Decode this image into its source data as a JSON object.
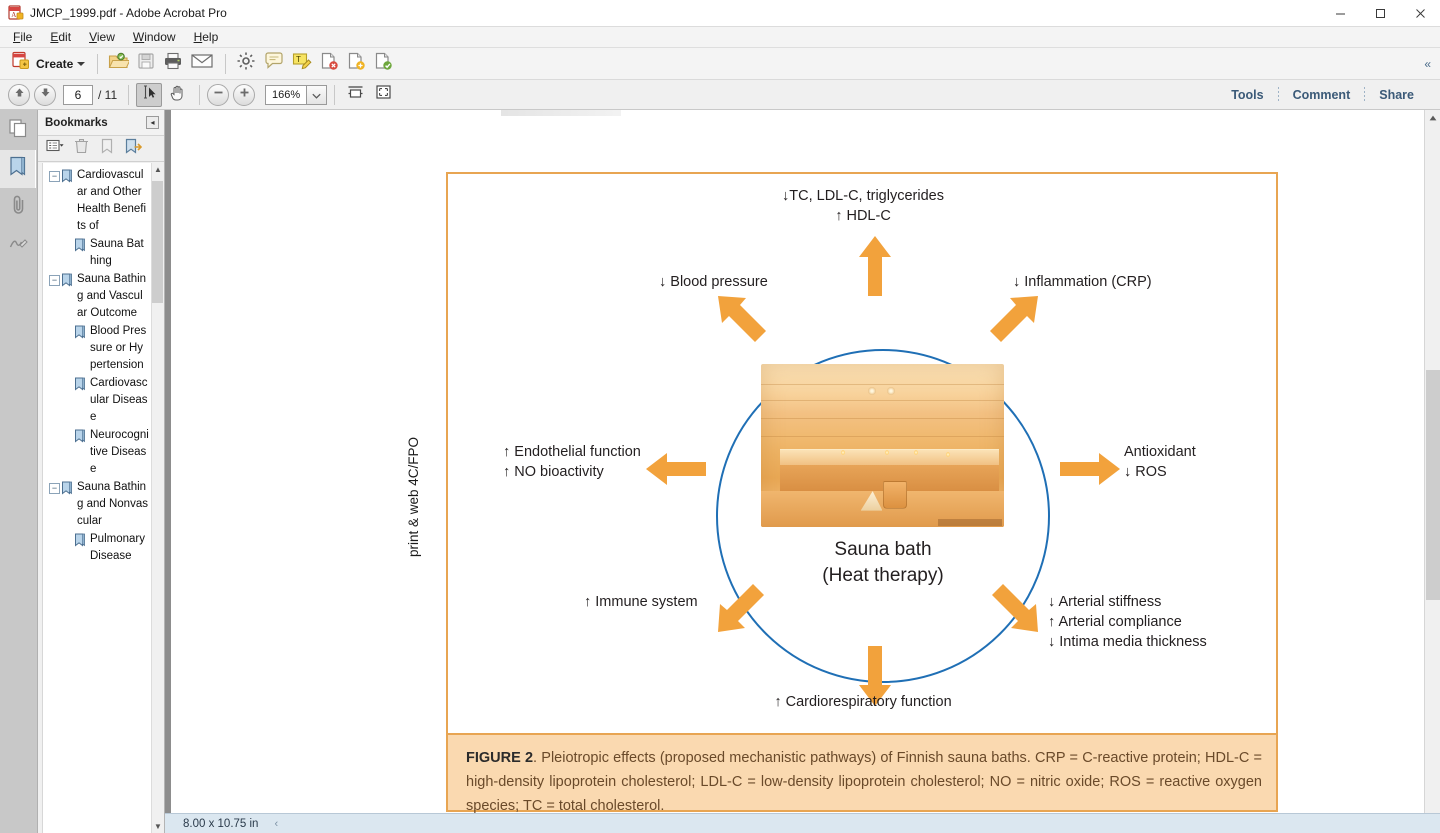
{
  "window": {
    "title": "JMCP_1999.pdf - Adobe Acrobat Pro",
    "app_icon": "acrobat-icon",
    "minimize_label": "─",
    "maximize_label": "☐",
    "close_label": "✕"
  },
  "menubar": {
    "items": [
      {
        "label": "File",
        "mnemonic": "F"
      },
      {
        "label": "Edit",
        "mnemonic": "E"
      },
      {
        "label": "View",
        "mnemonic": "V"
      },
      {
        "label": "Window",
        "mnemonic": "W"
      },
      {
        "label": "Help",
        "mnemonic": "H"
      }
    ]
  },
  "toolbar": {
    "create_label": "Create",
    "icons": [
      "create-pdf-icon",
      "open-file-icon",
      "save-icon",
      "print-icon",
      "email-icon",
      "settings-icon",
      "sticky-note-icon",
      "highlight-text-icon",
      "export-pdf-icon",
      "create-pdf-tool-icon",
      "send-for-review-icon"
    ],
    "collapse_label": "«"
  },
  "navbar": {
    "previous_page_icon": "arrow-up-icon",
    "next_page_icon": "arrow-down-icon",
    "page_number": "6",
    "page_total": "/ 11",
    "select_tool_icon": "select-text-icon",
    "hand_tool_icon": "hand-icon",
    "zoom_out_icon": "zoom-out-icon",
    "zoom_in_icon": "zoom-in-icon",
    "zoom_level": "166%",
    "zoom_dropdown_icon": "chevron-down-icon",
    "fit_width_icon": "fit-width-icon",
    "fit_page_icon": "fit-page-icon",
    "right_buttons": [
      "Tools",
      "Comment",
      "Share"
    ]
  },
  "rail": {
    "items": [
      {
        "name": "page-thumbnails",
        "icon": "pages-icon",
        "active": false
      },
      {
        "name": "bookmarks",
        "icon": "bookmark-icon",
        "active": true
      },
      {
        "name": "attachments",
        "icon": "paperclip-icon",
        "active": false
      },
      {
        "name": "signatures",
        "icon": "signature-icon",
        "active": false
      }
    ]
  },
  "bookmarks_panel": {
    "title": "Bookmarks",
    "collapse_label": "◂",
    "toolbar_icons": [
      "options-menu-icon",
      "delete-bookmark-icon",
      "new-bookmark-icon",
      "expand-bookmark-icon"
    ],
    "scroll_up_label": "▲",
    "scroll_down_label": "▼",
    "tree": [
      {
        "label": "Cardiovascular and Other Health Benefits of",
        "level": 0,
        "expander": "−"
      },
      {
        "label": "Sauna Bathing",
        "level": 1,
        "expander": ""
      },
      {
        "label": "Sauna Bathing and Vascular Outcome",
        "level": 0,
        "expander": "−"
      },
      {
        "label": "Blood Pressure or Hypertension",
        "level": 1,
        "expander": ""
      },
      {
        "label": "Cardiovascular Disease",
        "level": 1,
        "expander": ""
      },
      {
        "label": "Neurocognitive Disease",
        "level": 1,
        "expander": ""
      },
      {
        "label": "Sauna Bathing and Nonvascular",
        "level": 0,
        "expander": "−"
      },
      {
        "label": "Pulmonary Disease",
        "level": 1,
        "expander": ""
      }
    ]
  },
  "statusbar": {
    "page_size": "8.00 x 10.75 in",
    "expand_label": "‹"
  },
  "figure": {
    "vertical_note": "print & web 4C/FPO",
    "center": {
      "title": "Sauna bath",
      "subtitle": "(Heat therapy)",
      "image_alt": "sauna-interior-photo"
    },
    "labels": [
      {
        "id": "top",
        "lines": [
          "↓TC, LDL-C, triglycerides",
          "↑ HDL-C"
        ]
      },
      {
        "id": "top-left",
        "lines": [
          "↓ Blood pressure"
        ]
      },
      {
        "id": "top-right",
        "lines": [
          "↓ Inflammation (CRP)"
        ]
      },
      {
        "id": "left",
        "lines": [
          "↑ Endothelial function",
          "↑ NO bioactivity"
        ]
      },
      {
        "id": "right",
        "lines": [
          "Antioxidant",
          "↓ ROS"
        ]
      },
      {
        "id": "bottom-left",
        "lines": [
          "↑ Immune system"
        ]
      },
      {
        "id": "bottom-right",
        "lines": [
          "↓ Arterial stiffness",
          "↑ Arterial compliance",
          "↓ Intima media thickness"
        ]
      },
      {
        "id": "bottom",
        "lines": [
          "↑ Cardiorespiratory function"
        ]
      }
    ],
    "caption": {
      "label": "FIGURE 2",
      "text": ". Pleiotropic effects (proposed mechanistic pathways) of Finnish sauna baths. CRP = C-reactive protein; HDL-C = high-density lipoprotein cholesterol; LDL-C = low-density lipoprotein cholesterol; NO = nitric oxide; ROS = reactive oxygen species; TC = total cholesterol."
    },
    "colors": {
      "arrow": "#F2A23C",
      "circle": "#1F6FB5",
      "border": "#E8A552",
      "caption_bg": "#FAD9B0"
    }
  }
}
